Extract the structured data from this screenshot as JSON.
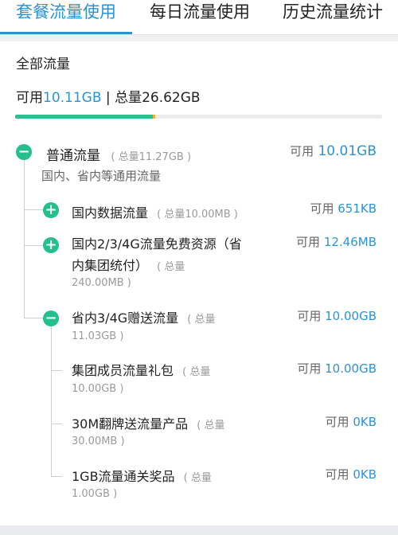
{
  "tabs": [
    {
      "label": "套餐流量使用",
      "active": true
    },
    {
      "label": "每日流量使用",
      "active": false
    },
    {
      "label": "历史流量统计",
      "active": false
    }
  ],
  "summary": {
    "title": "全部流量",
    "available_label": "可用",
    "available_value": "10.11GB",
    "separator": " | ",
    "total_label": "总量",
    "total_value": "26.62GB",
    "used_fraction": 0.375
  },
  "tree": {
    "root": {
      "name": "普通流量",
      "total": "( 总量11.27GB )",
      "desc": "国内、省内等通用流量",
      "avail_label": "可用",
      "avail_value": "10.01GB",
      "icon": "minus-circle"
    },
    "nodes": [
      {
        "name_lines": [
          "国内数据流量"
        ],
        "total_inline": "( 总量10.00MB )",
        "avail_label": "可用",
        "avail_value": "651KB",
        "icon": "plus-circle"
      },
      {
        "name_lines": [
          "国内2/3/4G流量免费资源（省",
          "内集团统付）"
        ],
        "total_inline": "( 总量",
        "total_cont": "240.00MB )",
        "avail_label": "可用",
        "avail_value": "12.46MB",
        "icon": "plus-circle"
      },
      {
        "name_lines": [
          "省内3/4G赠送流量"
        ],
        "total_inline": "( 总量",
        "total_cont": "11.03GB )",
        "avail_label": "可用",
        "avail_value": "10.00GB",
        "icon": "minus-circle"
      }
    ],
    "leaves": [
      {
        "name": "集团成员流量礼包",
        "total_inline": "( 总量",
        "total_cont": "10.00GB )",
        "avail_label": "可用",
        "avail_value": "10.00GB"
      },
      {
        "name": "30M翻牌送流量产品",
        "total_inline": "( 总量",
        "total_cont": "30.00MB )",
        "avail_label": "可用",
        "avail_value": "0KB"
      },
      {
        "name": "1GB流量通关奖品",
        "total_inline": "( 总量",
        "total_cont": "1.00GB )",
        "avail_label": "可用",
        "avail_value": "0KB"
      }
    ]
  },
  "colors": {
    "accent": "#2a93d5",
    "green": "#24bf8b",
    "bar_fill": "#2dc08f",
    "bar_tip": "#f2b02e"
  }
}
